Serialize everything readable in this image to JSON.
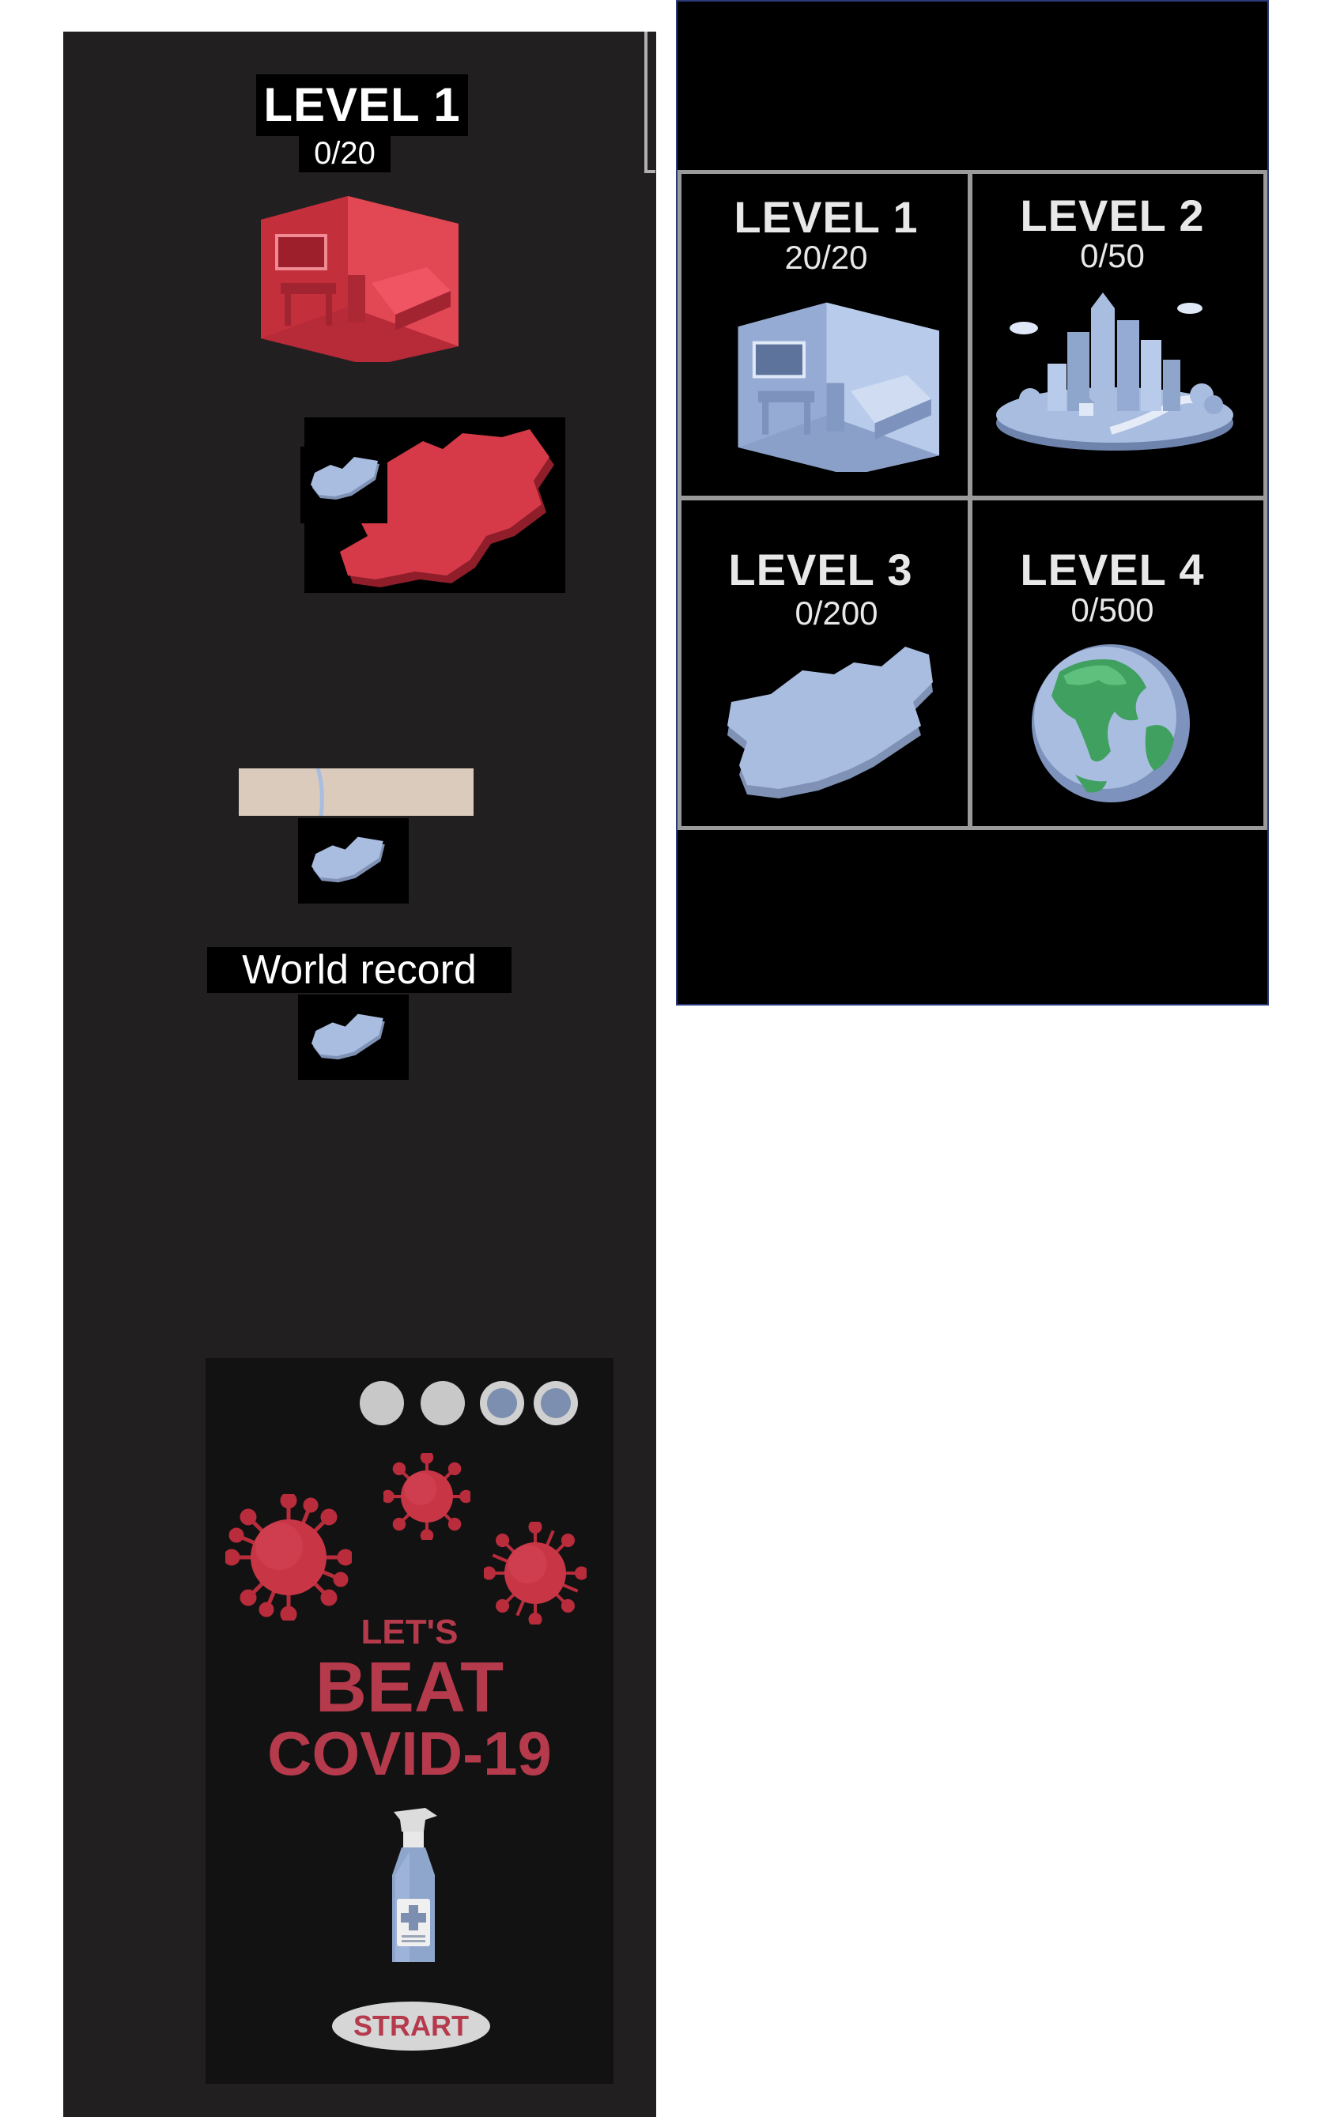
{
  "left_screen": {
    "level_title": "LEVEL 1",
    "level_progress": "0/20",
    "world_record_label": "World record"
  },
  "start_screen": {
    "page_dots": [
      {
        "color": "#c8c8c8",
        "active": false
      },
      {
        "color": "#c8c8c8",
        "active": false
      },
      {
        "color": "#7d8fb0",
        "active": true
      },
      {
        "color": "#7d8fb0",
        "active": true
      }
    ],
    "headline_small": "LET'S",
    "headline_big": "BEAT",
    "headline_line3": "COVID-19",
    "start_button": "STRART"
  },
  "level_select": {
    "levels": [
      {
        "title": "LEVEL 1",
        "progress": "20/20",
        "icon": "room-icon"
      },
      {
        "title": "LEVEL 2",
        "progress": "0/50",
        "icon": "city-icon"
      },
      {
        "title": "LEVEL 3",
        "progress": "0/200",
        "icon": "country-map-icon"
      },
      {
        "title": "LEVEL 4",
        "progress": "0/500",
        "icon": "globe-icon"
      }
    ]
  },
  "colors": {
    "accent_red": "#d63a48",
    "accent_blue": "#a9bde0",
    "text_red": "#b53a4b",
    "panel_bg": "#000000",
    "left_bg": "#221f20"
  }
}
